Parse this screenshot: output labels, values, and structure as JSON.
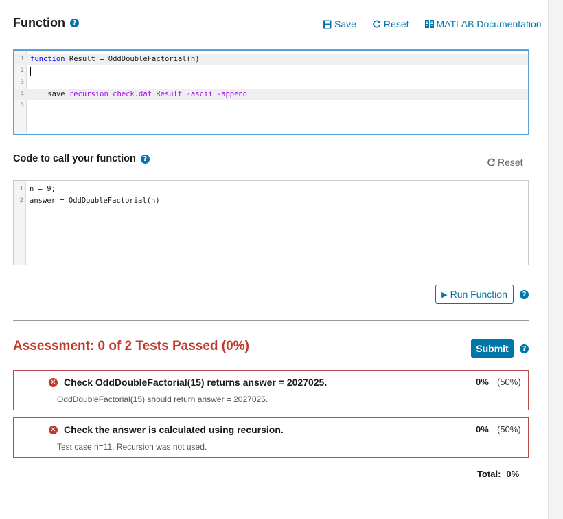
{
  "function_section": {
    "title": "Function",
    "help_glyph": "?",
    "toolbar": {
      "save_label": "Save",
      "reset_label": "Reset",
      "docs_label": "MATLAB Documentation"
    },
    "code": {
      "line_numbers": [
        "1",
        "2",
        "3",
        "4",
        "5"
      ],
      "line1_keyword": "function",
      "line1_rest": " Result = OddDoubleFactorial(n)",
      "line4_cmd": "    save ",
      "line4_args": "recursion_check.dat Result -ascii -append"
    }
  },
  "call_section": {
    "title": "Code to call your function",
    "help_glyph": "?",
    "reset_label": "Reset",
    "code": {
      "line_numbers": [
        "1",
        "2"
      ],
      "lines": [
        "n = 9;",
        "answer = OddDoubleFactorial(n)"
      ]
    }
  },
  "run_button": {
    "label": "Run Function",
    "glyph": "▶"
  },
  "assessment": {
    "title": "Assessment: 0 of 2 Tests Passed (0%)",
    "submit_label": "Submit",
    "help_glyph": "?",
    "fail_glyph": "✕",
    "tests": [
      {
        "title": "Check OddDoubleFactorial(15) returns answer = 2027025.",
        "description": "OddDoubleFactorial(15) should return answer = 2027025.",
        "score": "0%",
        "weight": "(50%)"
      },
      {
        "title": "Check the answer is calculated using recursion.",
        "description": "Test case n=11.  Recursion was not used.",
        "score": "0%",
        "weight": "(50%)"
      }
    ],
    "total_label": "Total:",
    "total_value": "0%"
  },
  "colors": {
    "accent": "#0076a8",
    "fail": "#c0392b",
    "editor_focus": "#5aa0d6"
  }
}
